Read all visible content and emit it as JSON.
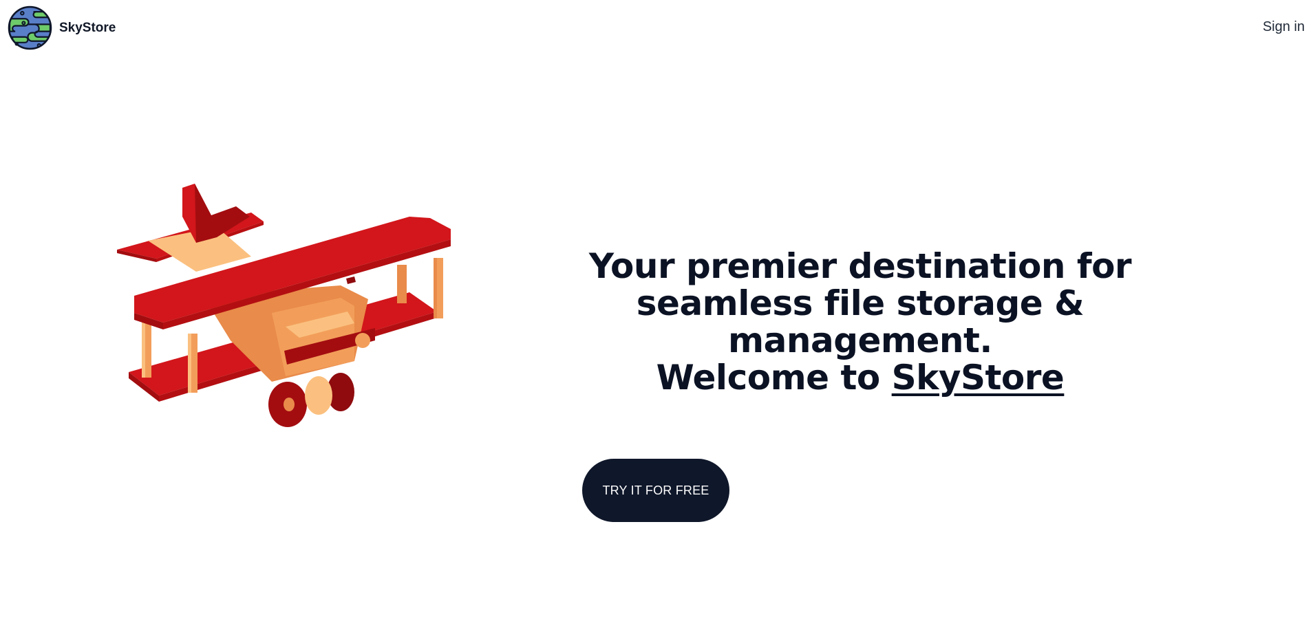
{
  "header": {
    "brand_name": "SkyStore",
    "logo_icon": "globe-logo-icon",
    "signin_label": "Sign in"
  },
  "hero": {
    "title_line1": "Your premier destination for",
    "title_line2": "seamless file storage & management.",
    "title_line3_prefix": "Welcome to ",
    "title_brand_link": "SkyStore",
    "illustration": "red-biplane-illustration",
    "cta_label": "TRY IT FOR FREE"
  },
  "colors": {
    "text_dark": "#0b1223",
    "button_bg": "#0f172a",
    "button_text": "#ffffff",
    "plane_red": "#d2161b",
    "plane_dark_red": "#a30d10",
    "plane_orange": "#e98b4a",
    "plane_peach": "#fbc07f",
    "logo_blue": "#5a7fc9",
    "logo_green": "#6ecb6a"
  }
}
